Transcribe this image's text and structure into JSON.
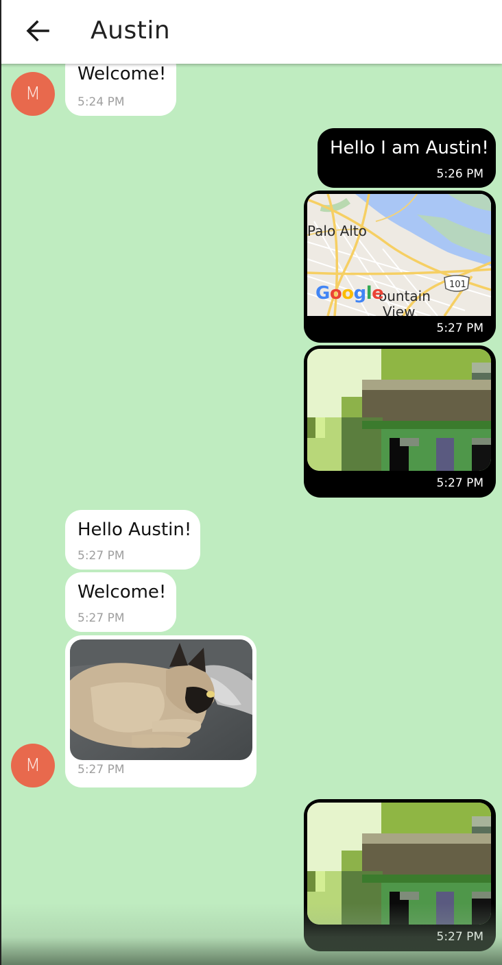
{
  "header": {
    "title": "Austin"
  },
  "avatar_initial": "M",
  "messages": [
    {
      "side": "in",
      "text": "Welcome!",
      "time": "5:24 PM"
    },
    {
      "side": "out",
      "text": "Hello I am Austin!",
      "time": "5:26 PM"
    },
    {
      "side": "out",
      "type": "map",
      "time": "5:27 PM"
    },
    {
      "side": "out",
      "type": "image",
      "time": "5:27 PM"
    },
    {
      "side": "in",
      "text": "Hello Austin!",
      "time": "5:27 PM"
    },
    {
      "side": "in",
      "text": "Welcome!",
      "time": "5:27 PM"
    },
    {
      "side": "in",
      "type": "photo",
      "time": "5:27 PM"
    },
    {
      "side": "out",
      "type": "image",
      "time": "5:27 PM"
    }
  ],
  "map": {
    "place_1": "Palo Alto",
    "place_2": "ountain",
    "place_3": "View",
    "highway": "101",
    "brand": "Google"
  },
  "colors": {
    "chat_bg": "#bfecc0",
    "outgoing": "#000000",
    "incoming": "#ffffff",
    "avatar": "#e8694d"
  }
}
